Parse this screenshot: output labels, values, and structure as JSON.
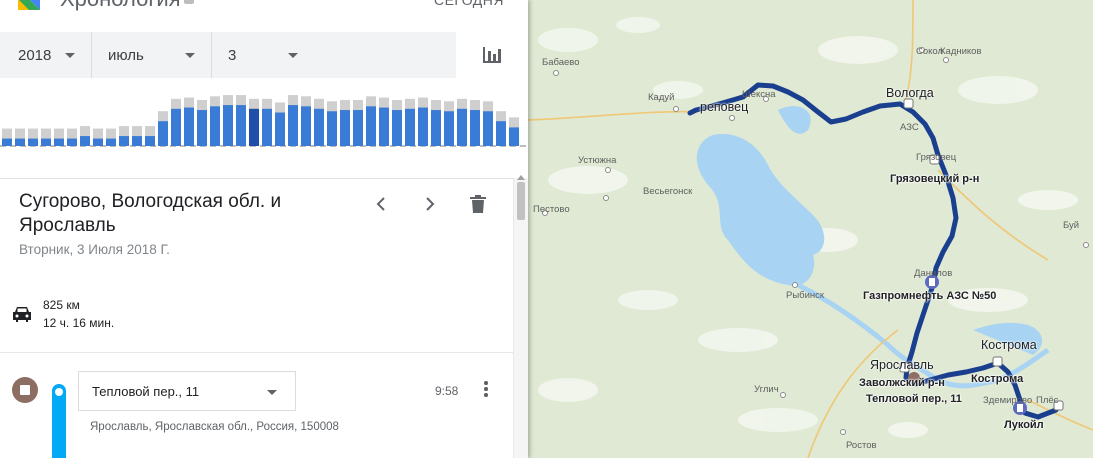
{
  "app": {
    "title": "Хронология",
    "today_label": "СЕГОДНЯ"
  },
  "selectors": {
    "year": "2018",
    "month": "июль",
    "day": "3"
  },
  "histogram": {
    "levels": [
      0.12,
      0.12,
      0.12,
      0.12,
      0.12,
      0.12,
      0.16,
      0.12,
      0.12,
      0.16,
      0.16,
      0.16,
      0.4,
      0.6,
      0.62,
      0.58,
      0.64,
      0.66,
      0.66,
      0.6,
      0.6,
      0.54,
      0.66,
      0.64,
      0.6,
      0.56,
      0.58,
      0.58,
      0.64,
      0.62,
      0.58,
      0.6,
      0.62,
      0.58,
      0.56,
      0.6,
      0.58,
      0.56,
      0.4,
      0.3
    ]
  },
  "day": {
    "title": "Сугорово, Вологодская обл. и Ярославль",
    "date": "Вторник, 3 Июля 2018 Г.",
    "distance": "825 км",
    "duration": "12 ч. 16 мин."
  },
  "visit": {
    "place": "Тепловой пер., 11",
    "time": "9:58",
    "address": "Ярославль, Ярославская обл., Россия, 150008"
  },
  "map": {
    "labels": {
      "babaevo": "Бабаево",
      "kaduy": "Кадуй",
      "cherepovets": "реповец",
      "sheksna": "Шексна",
      "sokol": "Сокол",
      "kadnikov": "Кадников",
      "vologda": "Вологда",
      "azs": "АЗС",
      "gryazovets": "Грязовец",
      "gryazovets_district": "Грязовецкий р-н",
      "ustyuzhna": "Устюжна",
      "vesyegonsk": "Весьегонск",
      "pestovo": "Пестово",
      "danilov": "Данилов",
      "gazprom": "Газпромнефть АЗС №50",
      "rybinsk": "Рыбинск",
      "kostroma_city": "Кострома",
      "kostroma_marker": "Кострома",
      "yaroslavl": "Ярославль",
      "zavolzhsky": "Заволжский р-н",
      "teplovoy": "Тепловой пер., 11",
      "uglich": "Углич",
      "lukoil": "Лукойл",
      "zdemirovo": "Здемирово",
      "buy": "Буй",
      "rostov": "Ростов",
      "plyos": "Плёс"
    }
  },
  "colors": {
    "route": "#1a3f8f",
    "water": "#a9d3f3",
    "land": "#dfe9d3",
    "bar": "#3a7bd5",
    "bar_selected": "#1f4fa8",
    "bar_bg": "#cfcfcf"
  }
}
